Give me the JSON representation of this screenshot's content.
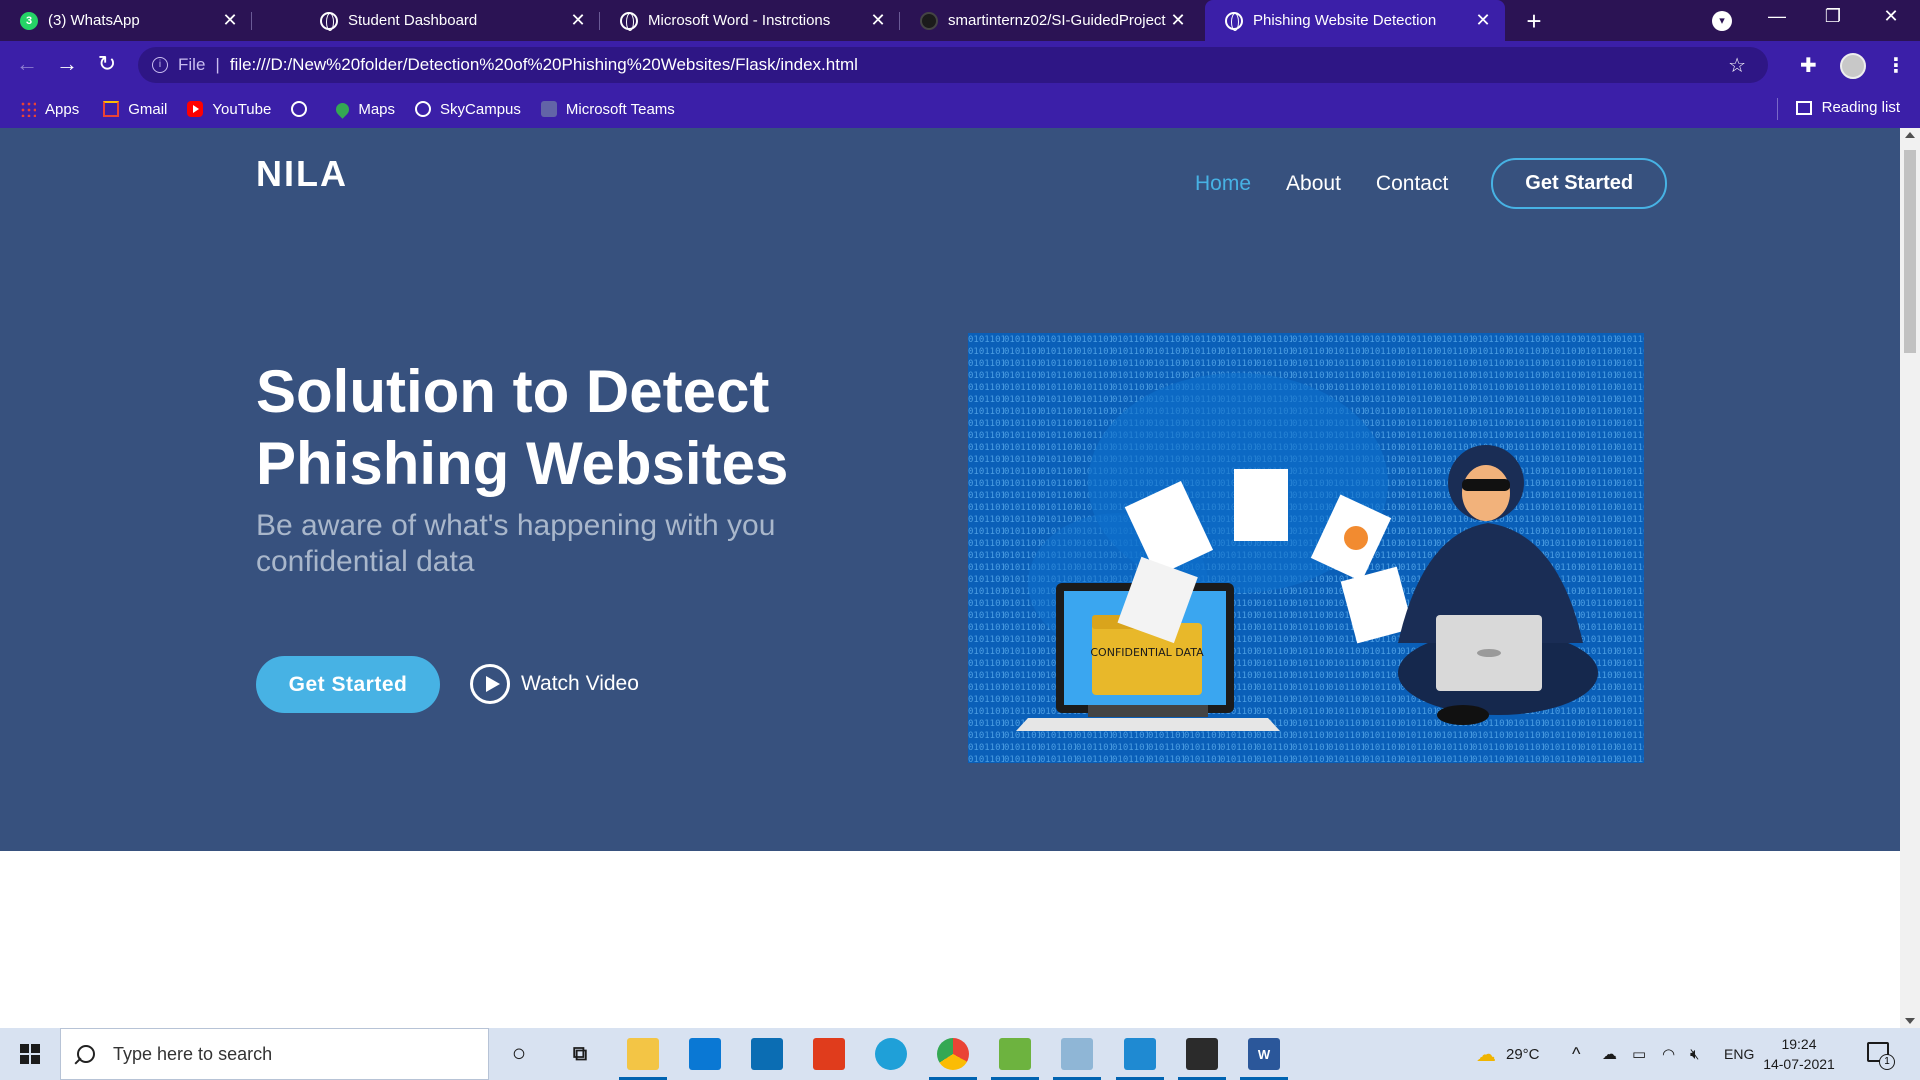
{
  "browser": {
    "tabs": [
      {
        "title": "(3) WhatsApp",
        "icon": "whatsapp-icon",
        "active": false
      },
      {
        "title": "Student Dashboard",
        "icon": "globe-icon",
        "active": false
      },
      {
        "title": "Microsoft Word - Instrctions",
        "icon": "globe-icon",
        "active": false
      },
      {
        "title": "smartinternz02/SI-GuidedProject",
        "icon": "github-icon",
        "active": false
      },
      {
        "title": "Phishing Website Detection",
        "icon": "globe-icon",
        "active": true
      }
    ],
    "close_glyph": "✕",
    "address": {
      "scheme_label": "File",
      "url": "file:///D:/New%20folder/Detection%20of%20Phishing%20Websites/Flask/index.html"
    },
    "bookmarks": [
      {
        "label": "Apps",
        "icon": "apps-icon"
      },
      {
        "label": "Gmail",
        "icon": "gmail-icon"
      },
      {
        "label": "YouTube",
        "icon": "youtube-icon"
      },
      {
        "label": "",
        "icon": "globe-icon"
      },
      {
        "label": "Maps",
        "icon": "maps-icon"
      },
      {
        "label": "SkyCampus",
        "icon": "globe-icon"
      },
      {
        "label": "Microsoft Teams",
        "icon": "teams-icon"
      }
    ],
    "reading_list": "Reading list"
  },
  "page": {
    "logo": "NILA",
    "nav": {
      "home": "Home",
      "about": "About",
      "contact": "Contact",
      "cta": "Get Started"
    },
    "hero": {
      "title": "Solution to Detect Phishing Websites",
      "subtitle": "Be aware of what's happening with you confidential data",
      "primary_button": "Get Started",
      "video_button": "Watch Video",
      "illustration_text": "CONFIDENTIAL DATA"
    },
    "colors": {
      "hero_bg": "#37517e",
      "accent": "#47b2e4",
      "tab_bar": "#2b1354",
      "chrome": "#3b1fa8"
    }
  },
  "taskbar": {
    "search_placeholder": "Type here to search",
    "weather": "29°C",
    "language": "ENG",
    "time": "19:24",
    "date": "14-07-2021",
    "notification_count": "1"
  }
}
